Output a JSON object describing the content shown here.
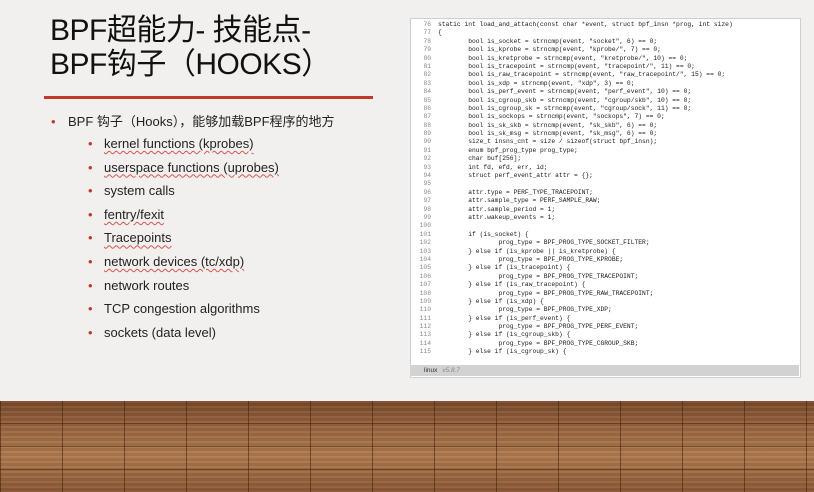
{
  "title": {
    "line1": "BPF超能力- 技能点-",
    "line2": "BPF钩子（HOOKS）"
  },
  "bullets": {
    "main": "BPF 钩子（Hooks），能够加载BPF程序的地方",
    "items": [
      "kernel functions (kprobes)",
      "userspace functions (uprobes)",
      "system calls",
      "fentry/fexit",
      "Tracepoints",
      "network devices (tc/xdp)",
      "network routes",
      "TCP congestion algorithms",
      "sockets (data level)"
    ]
  },
  "code": {
    "lines": [
      {
        "n": "76",
        "t": "static int load_and_attach(const char *event, struct bpf_insn *prog, int size)"
      },
      {
        "n": "77",
        "t": "{"
      },
      {
        "n": "78",
        "t": "        bool is_socket = strncmp(event, \"socket\", 6) == 0;"
      },
      {
        "n": "79",
        "t": "        bool is_kprobe = strncmp(event, \"kprobe/\", 7) == 0;"
      },
      {
        "n": "80",
        "t": "        bool is_kretprobe = strncmp(event, \"kretprobe/\", 10) == 0;"
      },
      {
        "n": "81",
        "t": "        bool is_tracepoint = strncmp(event, \"tracepoint/\", 11) == 0;"
      },
      {
        "n": "82",
        "t": "        bool is_raw_tracepoint = strncmp(event, \"raw_tracepoint/\", 15) == 0;"
      },
      {
        "n": "83",
        "t": "        bool is_xdp = strncmp(event, \"xdp\", 3) == 0;"
      },
      {
        "n": "84",
        "t": "        bool is_perf_event = strncmp(event, \"perf_event\", 10) == 0;"
      },
      {
        "n": "85",
        "t": "        bool is_cgroup_skb = strncmp(event, \"cgroup/skb\", 10) == 0;"
      },
      {
        "n": "86",
        "t": "        bool is_cgroup_sk = strncmp(event, \"cgroup/sock\", 11) == 0;"
      },
      {
        "n": "87",
        "t": "        bool is_sockops = strncmp(event, \"sockops\", 7) == 0;"
      },
      {
        "n": "88",
        "t": "        bool is_sk_skb = strncmp(event, \"sk_skb\", 6) == 0;"
      },
      {
        "n": "89",
        "t": "        bool is_sk_msg = strncmp(event, \"sk_msg\", 6) == 0;"
      },
      {
        "n": "90",
        "t": "        size_t insns_cnt = size / sizeof(struct bpf_insn);"
      },
      {
        "n": "91",
        "t": "        enum bpf_prog_type prog_type;"
      },
      {
        "n": "92",
        "t": "        char buf[256];"
      },
      {
        "n": "93",
        "t": "        int fd, efd, err, id;"
      },
      {
        "n": "94",
        "t": "        struct perf_event_attr attr = {};"
      },
      {
        "n": "95",
        "t": ""
      },
      {
        "n": "96",
        "t": "        attr.type = PERF_TYPE_TRACEPOINT;"
      },
      {
        "n": "97",
        "t": "        attr.sample_type = PERF_SAMPLE_RAW;"
      },
      {
        "n": "98",
        "t": "        attr.sample_period = 1;"
      },
      {
        "n": "99",
        "t": "        attr.wakeup_events = 1;"
      },
      {
        "n": "100",
        "t": ""
      },
      {
        "n": "101",
        "t": "        if (is_socket) {"
      },
      {
        "n": "102",
        "t": "                prog_type = BPF_PROG_TYPE_SOCKET_FILTER;"
      },
      {
        "n": "103",
        "t": "        } else if (is_kprobe || is_kretprobe) {"
      },
      {
        "n": "104",
        "t": "                prog_type = BPF_PROG_TYPE_KPROBE;"
      },
      {
        "n": "105",
        "t": "        } else if (is_tracepoint) {"
      },
      {
        "n": "106",
        "t": "                prog_type = BPF_PROG_TYPE_TRACEPOINT;"
      },
      {
        "n": "107",
        "t": "        } else if (is_raw_tracepoint) {"
      },
      {
        "n": "108",
        "t": "                prog_type = BPF_PROG_TYPE_RAW_TRACEPOINT;"
      },
      {
        "n": "109",
        "t": "        } else if (is_xdp) {"
      },
      {
        "n": "110",
        "t": "                prog_type = BPF_PROG_TYPE_XDP;"
      },
      {
        "n": "111",
        "t": "        } else if (is_perf_event) {"
      },
      {
        "n": "112",
        "t": "                prog_type = BPF_PROG_TYPE_PERF_EVENT;"
      },
      {
        "n": "113",
        "t": "        } else if (is_cgroup_skb) {"
      },
      {
        "n": "114",
        "t": "                prog_type = BPF_PROG_TYPE_CGROUP_SKB;"
      },
      {
        "n": "115",
        "t": "        } else if (is_cgroup_sk) {"
      }
    ],
    "footer_label": "linux",
    "footer_version": "v5.8.7"
  },
  "colors": {
    "accent": "#c0392b",
    "slide_bg": "#f1f0ee",
    "floor": "#9a6640"
  }
}
